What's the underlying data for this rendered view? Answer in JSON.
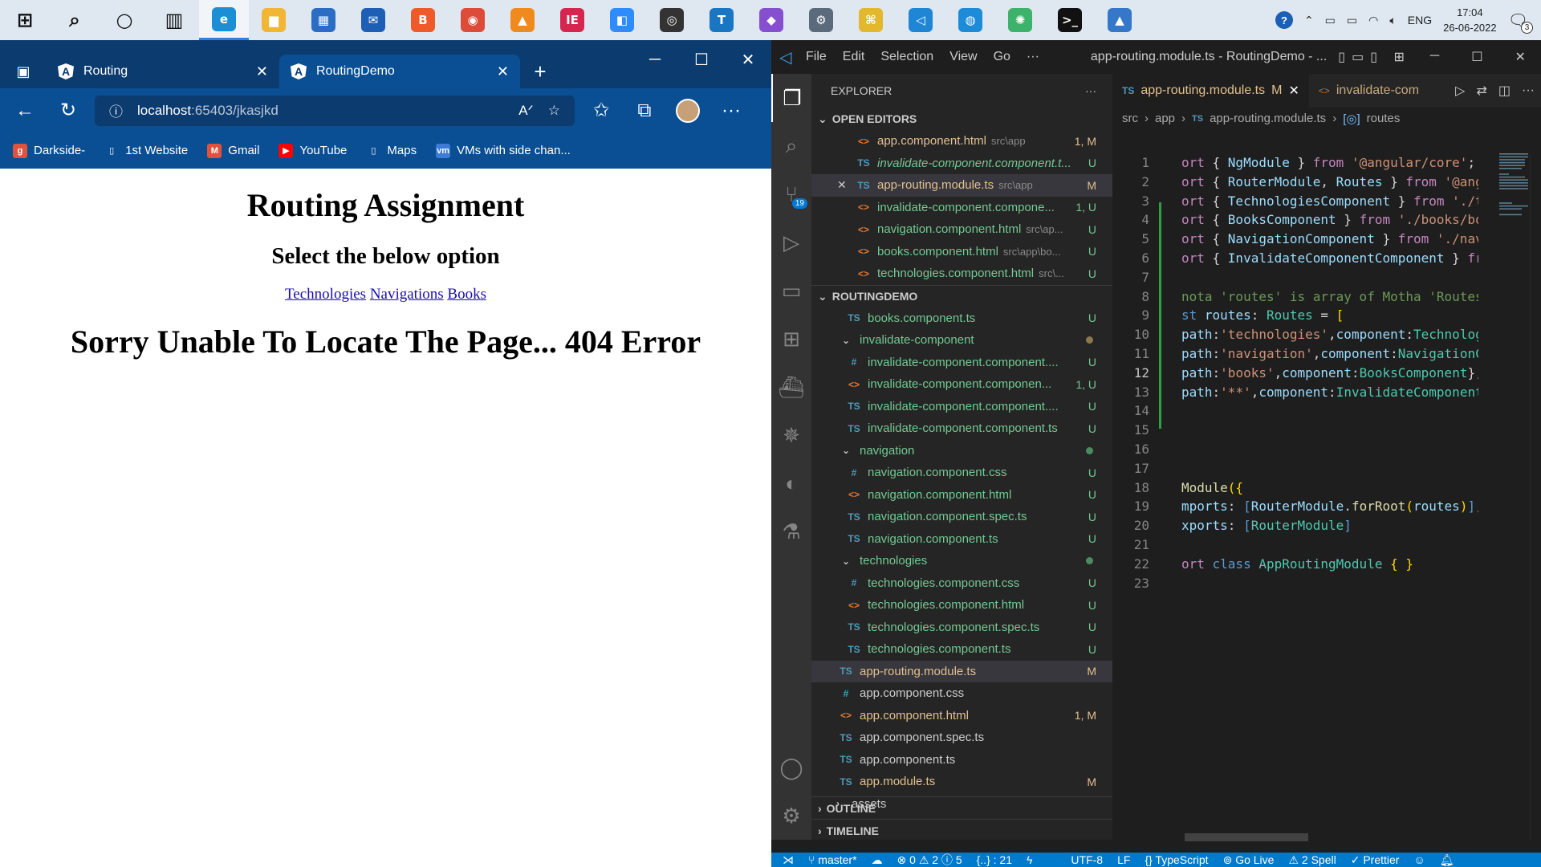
{
  "taskbar": {
    "apps": [
      {
        "name": "start",
        "label": "⊞",
        "color": "#dfe8f1"
      },
      {
        "name": "search",
        "label": "⌕",
        "color": "#dfe8f1"
      },
      {
        "name": "cortana",
        "label": "○",
        "color": "#dfe8f1"
      },
      {
        "name": "task-view",
        "label": "▥",
        "color": "#dfe8f1"
      },
      {
        "name": "edge",
        "label": "e",
        "color": "#1b8fd6"
      },
      {
        "name": "file-explorer",
        "label": "▆",
        "color": "#f2b636"
      },
      {
        "name": "store",
        "label": "▦",
        "color": "#2b6cc4"
      },
      {
        "name": "mail",
        "label": "✉",
        "color": "#1d5fb5"
      },
      {
        "name": "brave",
        "label": "B",
        "color": "#f05a2a"
      },
      {
        "name": "chrome",
        "label": "◉",
        "color": "#dd4b39"
      },
      {
        "name": "vlc",
        "label": "▲",
        "color": "#f08a1c"
      },
      {
        "name": "intellij",
        "label": "IE",
        "color": "#d6254f"
      },
      {
        "name": "zoom",
        "label": "◧",
        "color": "#2d8cff"
      },
      {
        "name": "obs",
        "label": "◎",
        "color": "#333333"
      },
      {
        "name": "teams-t",
        "label": "T",
        "color": "#1b76c2"
      },
      {
        "name": "visual-studio",
        "label": "◆",
        "color": "#864fd0"
      },
      {
        "name": "settings-app",
        "label": "⚙",
        "color": "#5b6b7c"
      },
      {
        "name": "tool-yellow",
        "label": "⌘",
        "color": "#e3b82d"
      },
      {
        "name": "vscode",
        "label": "◁",
        "color": "#1f86d6"
      },
      {
        "name": "disk-app",
        "label": "◍",
        "color": "#1c8bd8"
      },
      {
        "name": "atom",
        "label": "✺",
        "color": "#3db26a"
      },
      {
        "name": "terminal",
        "label": ">_",
        "color": "#111111"
      },
      {
        "name": "photos",
        "label": "▲",
        "color": "#3577c9"
      }
    ],
    "active_index": 4,
    "language": "ENG",
    "time": "17:04",
    "date": "26-06-2022",
    "notification_count": "3"
  },
  "browser": {
    "tabs": [
      {
        "label": "Routing"
      },
      {
        "label": "RoutingDemo"
      }
    ],
    "url_host": "localhost",
    "url_path": ":65403/jkasjkd",
    "bookmarks": [
      {
        "label": "Darkside-",
        "icon": "g",
        "color": "#e0523b"
      },
      {
        "label": "1st Website",
        "icon": "▯",
        "color": "transparent"
      },
      {
        "label": "Gmail",
        "icon": "M",
        "color": "#e0523b"
      },
      {
        "label": "YouTube",
        "icon": "▶",
        "color": "#ff0000"
      },
      {
        "label": "Maps",
        "icon": "▯",
        "color": "transparent"
      },
      {
        "label": "VMs with side chan...",
        "icon": "vm",
        "color": "#3c7bd6"
      }
    ],
    "page": {
      "title": "Routing Assignment",
      "subtitle": "Select the below option",
      "links": [
        "Technologies",
        "Navigations",
        "Books"
      ],
      "error": "Sorry Unable To Locate The Page... 404 Error"
    }
  },
  "vscode": {
    "menu": [
      "File",
      "Edit",
      "Selection",
      "View",
      "Go",
      "···"
    ],
    "window_title": "app-routing.module.ts - RoutingDemo - ...",
    "explorer_label": "EXPLORER",
    "open_editors_label": "OPEN EDITORS",
    "open_editors": [
      {
        "icon": "<>",
        "name": "app.component.html",
        "path": "src\\app",
        "status": "1, M",
        "cls": "c-mod"
      },
      {
        "icon": "TS",
        "name": "invalidate-component.component.t...",
        "path": "",
        "status": "U",
        "cls": "c-unt",
        "italic": true
      },
      {
        "icon": "TS",
        "name": "app-routing.module.ts",
        "path": "src\\app",
        "status": "M",
        "cls": "c-mod",
        "selected": true
      },
      {
        "icon": "<>",
        "name": "invalidate-component.compone...",
        "path": "",
        "status": "1, U",
        "cls": "c-unt"
      },
      {
        "icon": "<>",
        "name": "navigation.component.html",
        "path": "src\\ap...",
        "status": "U",
        "cls": "c-unt"
      },
      {
        "icon": "<>",
        "name": "books.component.html",
        "path": "src\\app\\bo...",
        "status": "U",
        "cls": "c-unt"
      },
      {
        "icon": "<>",
        "name": "technologies.component.html",
        "path": "src\\...",
        "status": "U",
        "cls": "c-unt"
      }
    ],
    "project_label": "ROUTINGDEMO",
    "tree": [
      {
        "indent": 2,
        "icon": "TS",
        "name": "books.component.ts",
        "status": "U",
        "cls": "c-unt"
      },
      {
        "indent": 1,
        "icon": "⌄",
        "name": "invalidate-component",
        "status": "dot",
        "cls": "c-unt",
        "folder": true,
        "dotcolor": "#8a7a4a"
      },
      {
        "indent": 2,
        "icon": "#",
        "name": "invalidate-component.component....",
        "status": "U",
        "cls": "c-unt"
      },
      {
        "indent": 2,
        "icon": "<>",
        "name": "invalidate-component.componen...",
        "status": "1, U",
        "cls": "c-unt"
      },
      {
        "indent": 2,
        "icon": "TS",
        "name": "invalidate-component.component....",
        "status": "U",
        "cls": "c-unt"
      },
      {
        "indent": 2,
        "icon": "TS",
        "name": "invalidate-component.component.ts",
        "status": "U",
        "cls": "c-unt"
      },
      {
        "indent": 1,
        "icon": "⌄",
        "name": "navigation",
        "status": "dot",
        "cls": "c-unt",
        "folder": true,
        "dotcolor": "#4b8c5e"
      },
      {
        "indent": 2,
        "icon": "#",
        "name": "navigation.component.css",
        "status": "U",
        "cls": "c-unt"
      },
      {
        "indent": 2,
        "icon": "<>",
        "name": "navigation.component.html",
        "status": "U",
        "cls": "c-unt"
      },
      {
        "indent": 2,
        "icon": "TS",
        "name": "navigation.component.spec.ts",
        "status": "U",
        "cls": "c-unt"
      },
      {
        "indent": 2,
        "icon": "TS",
        "name": "navigation.component.ts",
        "status": "U",
        "cls": "c-unt"
      },
      {
        "indent": 1,
        "icon": "⌄",
        "name": "technologies",
        "status": "dot",
        "cls": "c-unt",
        "folder": true,
        "dotcolor": "#4b8c5e"
      },
      {
        "indent": 2,
        "icon": "#",
        "name": "technologies.component.css",
        "status": "U",
        "cls": "c-unt"
      },
      {
        "indent": 2,
        "icon": "<>",
        "name": "technologies.component.html",
        "status": "U",
        "cls": "c-unt"
      },
      {
        "indent": 2,
        "icon": "TS",
        "name": "technologies.component.spec.ts",
        "status": "U",
        "cls": "c-unt"
      },
      {
        "indent": 2,
        "icon": "TS",
        "name": "technologies.component.ts",
        "status": "U",
        "cls": "c-unt"
      },
      {
        "indent": 1,
        "icon": "TS",
        "name": "app-routing.module.ts",
        "status": "M",
        "cls": "c-mod",
        "selected": true
      },
      {
        "indent": 1,
        "icon": "#",
        "name": "app.component.css",
        "status": "",
        "cls": "plain"
      },
      {
        "indent": 1,
        "icon": "<>",
        "name": "app.component.html",
        "status": "1, M",
        "cls": "c-mod"
      },
      {
        "indent": 1,
        "icon": "TS",
        "name": "app.component.spec.ts",
        "status": "",
        "cls": "plain"
      },
      {
        "indent": 1,
        "icon": "TS",
        "name": "app.component.ts",
        "status": "",
        "cls": "plain"
      },
      {
        "indent": 1,
        "icon": "TS",
        "name": "app.module.ts",
        "status": "M",
        "cls": "c-mod"
      },
      {
        "indent": 0,
        "icon": "›",
        "name": "assets",
        "status": "",
        "cls": "plain",
        "folder": true
      }
    ],
    "outline_label": "OUTLINE",
    "timeline_label": "TIMELINE",
    "editor_tabs": [
      {
        "icon": "TS",
        "label": "app-routing.module.ts",
        "status": "M",
        "active": true
      },
      {
        "icon": "<>",
        "label": "invalidate-com",
        "status": "",
        "active": false
      }
    ],
    "breadcrumb": [
      "src",
      "app",
      "app-routing.module.ts",
      "routes"
    ],
    "code": [
      [
        [
          "k",
          "ort "
        ],
        [
          "p",
          "{ "
        ],
        [
          "v",
          "NgModule"
        ],
        [
          "p",
          " } "
        ],
        [
          "k",
          "from "
        ],
        [
          "s",
          "'@angular/core'"
        ],
        [
          "p",
          ";"
        ]
      ],
      [
        [
          "k",
          "ort "
        ],
        [
          "p",
          "{ "
        ],
        [
          "v",
          "RouterModule"
        ],
        [
          "p",
          ", "
        ],
        [
          "v",
          "Routes"
        ],
        [
          "p",
          " } "
        ],
        [
          "k",
          "from "
        ],
        [
          "s",
          "'@angul"
        ]
      ],
      [
        [
          "k",
          "ort "
        ],
        [
          "p",
          "{ "
        ],
        [
          "v",
          "TechnologiesComponent"
        ],
        [
          "p",
          " } "
        ],
        [
          "k",
          "from "
        ],
        [
          "s",
          "'./tec"
        ]
      ],
      [
        [
          "k",
          "ort "
        ],
        [
          "p",
          "{ "
        ],
        [
          "v",
          "BooksComponent"
        ],
        [
          "p",
          " } "
        ],
        [
          "k",
          "from "
        ],
        [
          "s",
          "'./books/book"
        ]
      ],
      [
        [
          "k",
          "ort "
        ],
        [
          "p",
          "{ "
        ],
        [
          "v",
          "NavigationComponent"
        ],
        [
          "p",
          " } "
        ],
        [
          "k",
          "from "
        ],
        [
          "s",
          "'./navig"
        ]
      ],
      [
        [
          "k",
          "ort "
        ],
        [
          "p",
          "{ "
        ],
        [
          "v",
          "InvalidateComponentComponent"
        ],
        [
          "p",
          " } "
        ],
        [
          "k",
          "from"
        ]
      ],
      [],
      [
        [
          "cm",
          "nota 'routes' is array of Motha 'Routes'"
        ]
      ],
      [
        [
          "b",
          "st "
        ],
        [
          "v",
          "routes"
        ],
        [
          "p",
          ": "
        ],
        [
          "t",
          "Routes"
        ],
        [
          "p",
          " = "
        ],
        [
          "y",
          "["
        ]
      ],
      [
        [
          "v",
          "path"
        ],
        [
          "p",
          ":"
        ],
        [
          "s",
          "'technologies'"
        ],
        [
          "p",
          ","
        ],
        [
          "v",
          "component"
        ],
        [
          "p",
          ":"
        ],
        [
          "t",
          "Technologie"
        ]
      ],
      [
        [
          "v",
          "path"
        ],
        [
          "p",
          ":"
        ],
        [
          "s",
          "'navigation'"
        ],
        [
          "p",
          ","
        ],
        [
          "v",
          "component"
        ],
        [
          "p",
          ":"
        ],
        [
          "t",
          "NavigationCom"
        ]
      ],
      [
        [
          "v",
          "path"
        ],
        [
          "p",
          ":"
        ],
        [
          "s",
          "'books'"
        ],
        [
          "p",
          ","
        ],
        [
          "v",
          "component"
        ],
        [
          "p",
          ":"
        ],
        [
          "t",
          "BooksComponent"
        ],
        [
          "p",
          "},"
        ]
      ],
      [
        [
          "v",
          "path"
        ],
        [
          "p",
          ":"
        ],
        [
          "s",
          "'**'"
        ],
        [
          "p",
          ","
        ],
        [
          "v",
          "component"
        ],
        [
          "p",
          ":"
        ],
        [
          "t",
          "InvalidateComponentCo"
        ]
      ],
      [],
      [],
      [],
      [],
      [
        [
          "f",
          "Module"
        ],
        [
          "y",
          "({"
        ]
      ],
      [
        [
          "v",
          "mports"
        ],
        [
          "p",
          ": "
        ],
        [
          "b",
          "["
        ],
        [
          "v",
          "RouterModule"
        ],
        [
          "p",
          "."
        ],
        [
          "f",
          "forRoot"
        ],
        [
          "y",
          "("
        ],
        [
          "v",
          "routes"
        ],
        [
          "y",
          ")"
        ],
        [
          "b",
          "]"
        ],
        [
          "p",
          ","
        ]
      ],
      [
        [
          "v",
          "xports"
        ],
        [
          "p",
          ": "
        ],
        [
          "b",
          "["
        ],
        [
          "t",
          "RouterModule"
        ],
        [
          "b",
          "]"
        ]
      ],
      [],
      [
        [
          "k",
          "ort "
        ],
        [
          "b",
          "class "
        ],
        [
          "t",
          "AppRoutingModule"
        ],
        [
          "p",
          " "
        ],
        [
          "y",
          "{ }"
        ]
      ],
      []
    ],
    "current_line": 12,
    "status": {
      "branch": "master*",
      "problems": "⊗ 0 ⚠ 2 ⓘ 5",
      "braces": "{..} : 21",
      "encoding": "UTF-8",
      "eol": "LF",
      "language": "{} TypeScript",
      "golive": "Go Live",
      "spell": "⚠ 2 Spell",
      "prettier": "✓ Prettier"
    }
  }
}
